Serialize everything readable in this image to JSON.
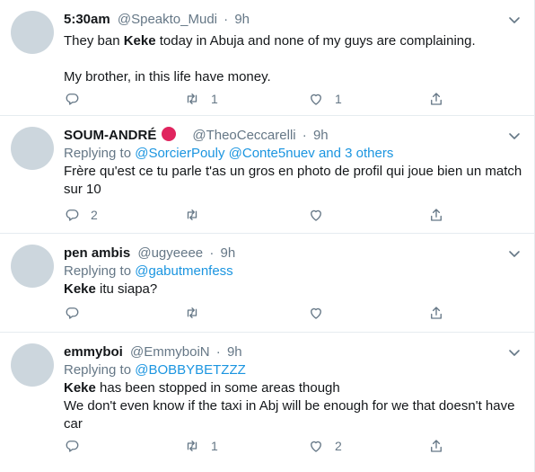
{
  "tweets": [
    {
      "name": "5:30am",
      "handle": "@Speakto_Mudi",
      "time": "9h",
      "replying_label": "",
      "replying_to": "",
      "text_bold": "Keke",
      "text_before": "They ban ",
      "text_after": " today in Abuja and none of my guys are complaining.\n\nMy brother, in this life have money.",
      "replies": "",
      "retweets": "1",
      "likes": "1"
    },
    {
      "name": "SOUM-ANDRÉ",
      "handle": "@TheoCeccarelli",
      "time": "9h",
      "replying_label": "Replying to",
      "replying_to": "@SorcierPouly @Conte5nuev and 3 others",
      "text_bold": "",
      "text_before": "Frère qu'est ce tu parle t'as un gros en photo de profil qui joue bien un match sur 10",
      "text_after": "",
      "replies": "2",
      "retweets": "",
      "likes": ""
    },
    {
      "name": "pen ambis",
      "handle": "@ugyeeee",
      "time": "9h",
      "replying_label": "Replying to",
      "replying_to": "@gabutmenfess",
      "text_bold": "Keke",
      "text_before": "",
      "text_after": " itu siapa?",
      "replies": "",
      "retweets": "",
      "likes": ""
    },
    {
      "name": "emmyboi",
      "handle": "@EmmyboiN",
      "time": "9h",
      "replying_label": "Replying to",
      "replying_to": "@BOBBYBETZZZ",
      "text_bold": "Keke",
      "text_before": "",
      "text_after": " has been stopped in some areas though\nWe don't even know if the taxi in Abj will be enough for we that doesn't have car",
      "replies": "",
      "retweets": "1",
      "likes": "2"
    }
  ],
  "colors": {
    "secondary": "#657786",
    "link": "#1b95e0",
    "flag": "#e0245e",
    "avatar": "#ccd6dd",
    "border": "#e6ecf0"
  },
  "icons": [
    "reply-icon",
    "retweet-icon",
    "like-icon",
    "share-icon",
    "chevron-down-icon"
  ]
}
